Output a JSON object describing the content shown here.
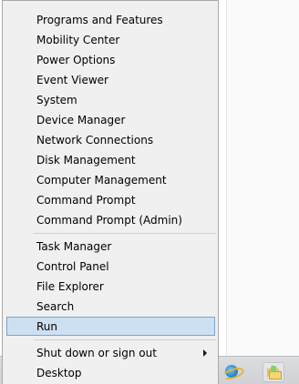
{
  "menu": {
    "group1": [
      {
        "label": "Programs and Features"
      },
      {
        "label": "Mobility Center"
      },
      {
        "label": "Power Options"
      },
      {
        "label": "Event Viewer"
      },
      {
        "label": "System"
      },
      {
        "label": "Device Manager"
      },
      {
        "label": "Network Connections"
      },
      {
        "label": "Disk Management"
      },
      {
        "label": "Computer Management"
      },
      {
        "label": "Command Prompt"
      },
      {
        "label": "Command Prompt (Admin)"
      }
    ],
    "group2": [
      {
        "label": "Task Manager"
      },
      {
        "label": "Control Panel"
      },
      {
        "label": "File Explorer"
      },
      {
        "label": "Search"
      },
      {
        "label": "Run",
        "highlighted": true
      }
    ],
    "group3": [
      {
        "label": "Shut down or sign out",
        "has_submenu": true
      },
      {
        "label": "Desktop"
      }
    ]
  },
  "taskbar": {
    "pinned": [
      {
        "icon": "internet-explorer-icon"
      },
      {
        "icon": "file-explorer-icon"
      }
    ]
  },
  "colors": {
    "menu_background": "#f0f0f0",
    "highlight_fill": "#cde0f2",
    "highlight_border": "#7da2ce"
  }
}
